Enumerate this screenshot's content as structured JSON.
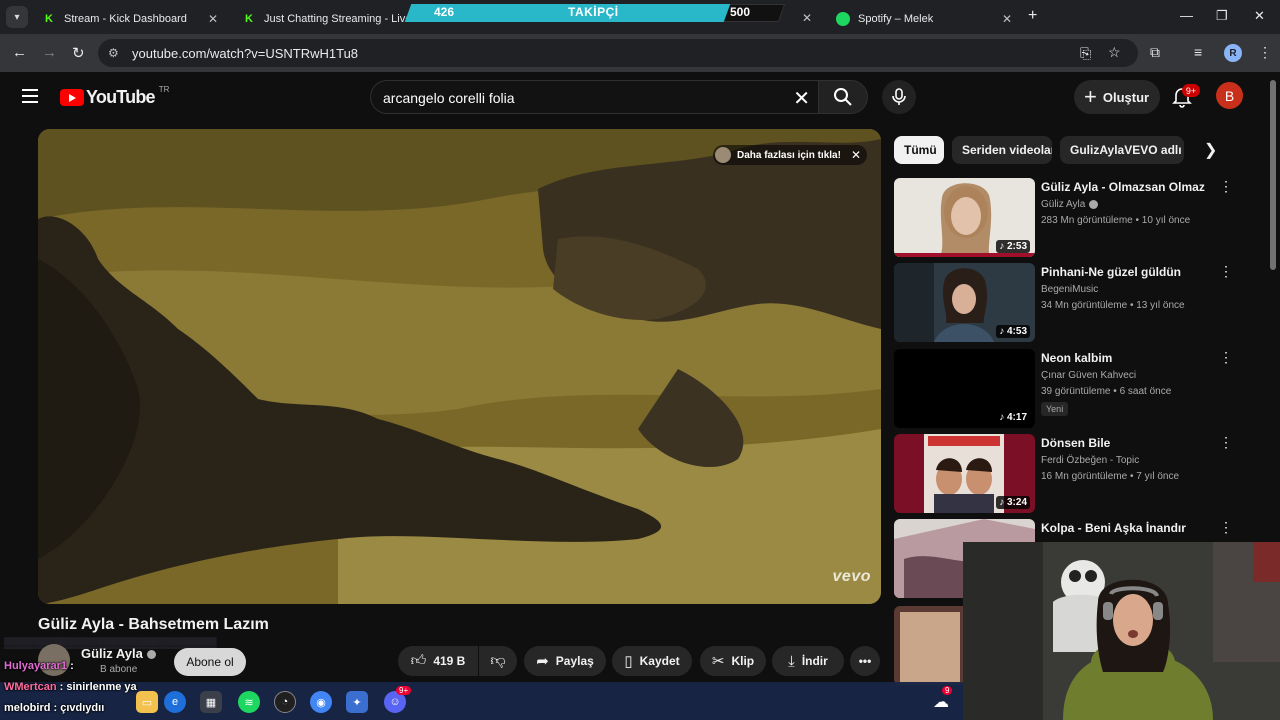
{
  "browser": {
    "tabs": [
      {
        "title": "Stream - Kick Dashboard",
        "favicon": "kick-icon"
      },
      {
        "title": "Just Chatting Streaming - Live S",
        "favicon": "kick-icon"
      },
      {
        "title": "Spotify – Melek",
        "favicon": "spotify-icon"
      }
    ],
    "url": "youtube.com/watch?v=USNTRwH1Tu8",
    "profile_initial": "R"
  },
  "follower_goal": {
    "current": "426",
    "label": "TAKİPÇİ",
    "goal": "500",
    "progress": 0.852,
    "color": "#28b8c9"
  },
  "youtube": {
    "logo_text": "YouTube",
    "country": "TR",
    "search_query": "arcangelo corelli folia",
    "create_label": "Oluştur",
    "notif_count": "9+",
    "avatar_initial": "B",
    "brand_color": "#ff0000"
  },
  "video": {
    "title": "Güliz Ayla - Bahsetmem Lazım",
    "card_teaser": "Daha fazlası için tıkla!",
    "watermark": "vevo",
    "channel": "Güliz Ayla",
    "subscribers": "B abone",
    "subscribe_label": "Abone ol",
    "likes": "419 B",
    "share_label": "Paylaş",
    "save_label": "Kaydet",
    "clip_label": "Klip",
    "download_label": "İndir"
  },
  "chips": [
    "Tümü",
    "Seriden videolar",
    "GulizAylaVEVO adlı yü"
  ],
  "recommendations": [
    {
      "title": "Güliz Ayla - Olmazsan Olmaz",
      "channel": "Güliz Ayla",
      "verified": true,
      "views": "283 Mn görüntüleme",
      "age": "10 yıl önce",
      "duration": "2:53",
      "badge": ""
    },
    {
      "title": "Pinhani-Ne güzel güldün",
      "channel": "BegeniMusic",
      "verified": false,
      "views": "34 Mn görüntüleme",
      "age": "13 yıl önce",
      "duration": "4:53",
      "badge": ""
    },
    {
      "title": "Neon kalbim",
      "channel": "Çınar Güven Kahveci",
      "verified": false,
      "views": "39 görüntüleme",
      "age": "6 saat önce",
      "duration": "4:17",
      "badge": "Yeni"
    },
    {
      "title": "Dönsen Bile",
      "channel": "Ferdi Özbeğen - Topic",
      "verified": false,
      "views": "16 Mn görüntüleme",
      "age": "7 yıl önce",
      "duration": "3:24",
      "badge": ""
    },
    {
      "title": "Kolpa - Beni Aşka İnandır",
      "channel": "",
      "verified": false,
      "views": "",
      "age": "",
      "duration": "",
      "badge": ""
    }
  ],
  "chat": [
    {
      "user": "Hulyayarar1",
      "message": ":"
    },
    {
      "user": "WMertcan",
      "message": ": sinirlenme ya"
    },
    {
      "user": "melobird",
      "message": ": çıvdıydıı"
    }
  ],
  "taskbar": {
    "discord_badge": "9+",
    "tray_badge": "9"
  }
}
